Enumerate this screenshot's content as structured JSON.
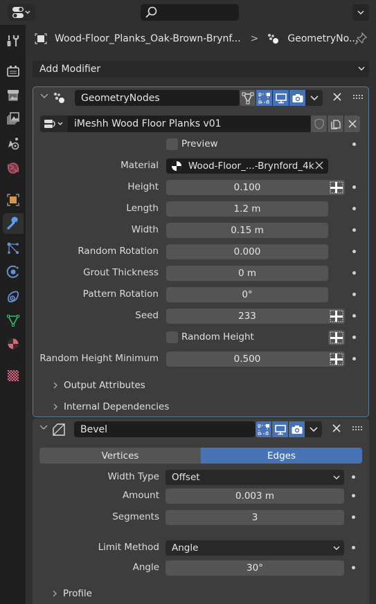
{
  "header": {
    "editor_type_icon": "properties-editor-icon",
    "search_placeholder": "",
    "search_icon": "search-icon"
  },
  "tabs": [
    {
      "name": "tool",
      "icon": "tool-icon",
      "active": false
    },
    {
      "name": "render",
      "icon": "render-icon",
      "active": false
    },
    {
      "name": "output",
      "icon": "output-icon",
      "active": false
    },
    {
      "name": "view-layer",
      "icon": "view-layer-icon",
      "active": false
    },
    {
      "name": "scene",
      "icon": "scene-icon",
      "active": false
    },
    {
      "name": "world",
      "icon": "world-icon",
      "active": false
    },
    {
      "name": "object",
      "icon": "object-icon",
      "active": false
    },
    {
      "name": "modifiers",
      "icon": "wrench-icon",
      "active": true
    },
    {
      "name": "particles",
      "icon": "particles-icon",
      "active": false
    },
    {
      "name": "physics",
      "icon": "physics-icon",
      "active": false
    },
    {
      "name": "constraints",
      "icon": "constraints-icon",
      "active": false
    },
    {
      "name": "data",
      "icon": "mesh-data-icon",
      "active": false
    },
    {
      "name": "material",
      "icon": "material-icon",
      "active": false
    },
    {
      "name": "texture",
      "icon": "texture-icon",
      "active": false
    }
  ],
  "breadcrumb": {
    "object": "Wood-Floor_Planks_Oak-Brown-Brynf...",
    "separator": ">",
    "modifier": "GeometryNo..."
  },
  "add_modifier": {
    "label": "Add Modifier"
  },
  "geometry_nodes": {
    "name": "GeometryNodes",
    "node_group": "iMeshh Wood Floor Planks v01",
    "preview": {
      "label": "Preview",
      "checked": false
    },
    "material": {
      "label": "Material",
      "value": "Wood-Floor_...-Brynford_4k"
    },
    "fields": [
      {
        "label": "Height",
        "value": "0.100",
        "attr_toggle": true
      },
      {
        "label": "Length",
        "value": "1.2 m",
        "attr_toggle": false
      },
      {
        "label": "Width",
        "value": "0.15 m",
        "attr_toggle": false
      },
      {
        "label": "Random Rotation",
        "value": "0.000",
        "attr_toggle": false
      },
      {
        "label": "Grout Thickness",
        "value": "0 m",
        "attr_toggle": false
      },
      {
        "label": "Pattern Rotation",
        "value": "0°",
        "attr_toggle": false
      },
      {
        "label": "Seed",
        "value": "233",
        "attr_toggle": true
      }
    ],
    "random_height": {
      "label": "Random Height",
      "checked": false
    },
    "random_height_min": {
      "label": "Random Height Minimum",
      "value": "0.500"
    },
    "subpanels": [
      "Output Attributes",
      "Internal Dependencies"
    ]
  },
  "bevel": {
    "name": "Bevel",
    "affect": {
      "options": [
        "Vertices",
        "Edges"
      ],
      "selected": "Edges"
    },
    "width_type": {
      "label": "Width Type",
      "value": "Offset"
    },
    "amount": {
      "label": "Amount",
      "value": "0.003 m"
    },
    "segments": {
      "label": "Segments",
      "value": "3"
    },
    "limit_method": {
      "label": "Limit Method",
      "value": "Angle"
    },
    "angle": {
      "label": "Angle",
      "value": "30°"
    },
    "subpanels": [
      "Profile"
    ]
  },
  "colors": {
    "accent": "#4772b3",
    "panel_bg": "#3d3d3d",
    "field_bg": "#545454"
  }
}
